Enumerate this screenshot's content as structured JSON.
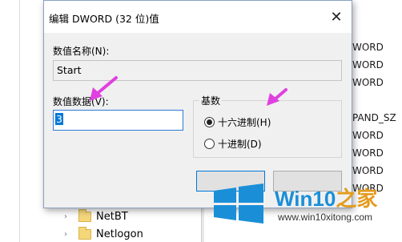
{
  "background": {
    "value_types": [
      "WORD",
      "WORD",
      "WORD",
      "PAND_SZ",
      "WORD",
      "WORD",
      "WORD",
      "WORD"
    ],
    "tree_items": [
      "NetBT",
      "Netlogon"
    ]
  },
  "dialog": {
    "title": "编辑 DWORD (32 位)值",
    "close_label": "✕",
    "value_name_label": "数值名称(N):",
    "value_name": "Start",
    "value_data_label": "数值数据(V):",
    "value_data": "3",
    "base_label": "基数",
    "hex_label": "十六进制(H)",
    "dec_label": "十进制(D)",
    "selected_base": "hex",
    "ok_label": "",
    "cancel_label": ""
  },
  "watermark": {
    "title_prefix": "Win10",
    "title_suffix": "之家",
    "url": "www.win10xitong.com"
  },
  "colors": {
    "arrow": "#e040e0",
    "win_blue": "#1a8fd8",
    "brand_orange": "#e39b1c"
  }
}
